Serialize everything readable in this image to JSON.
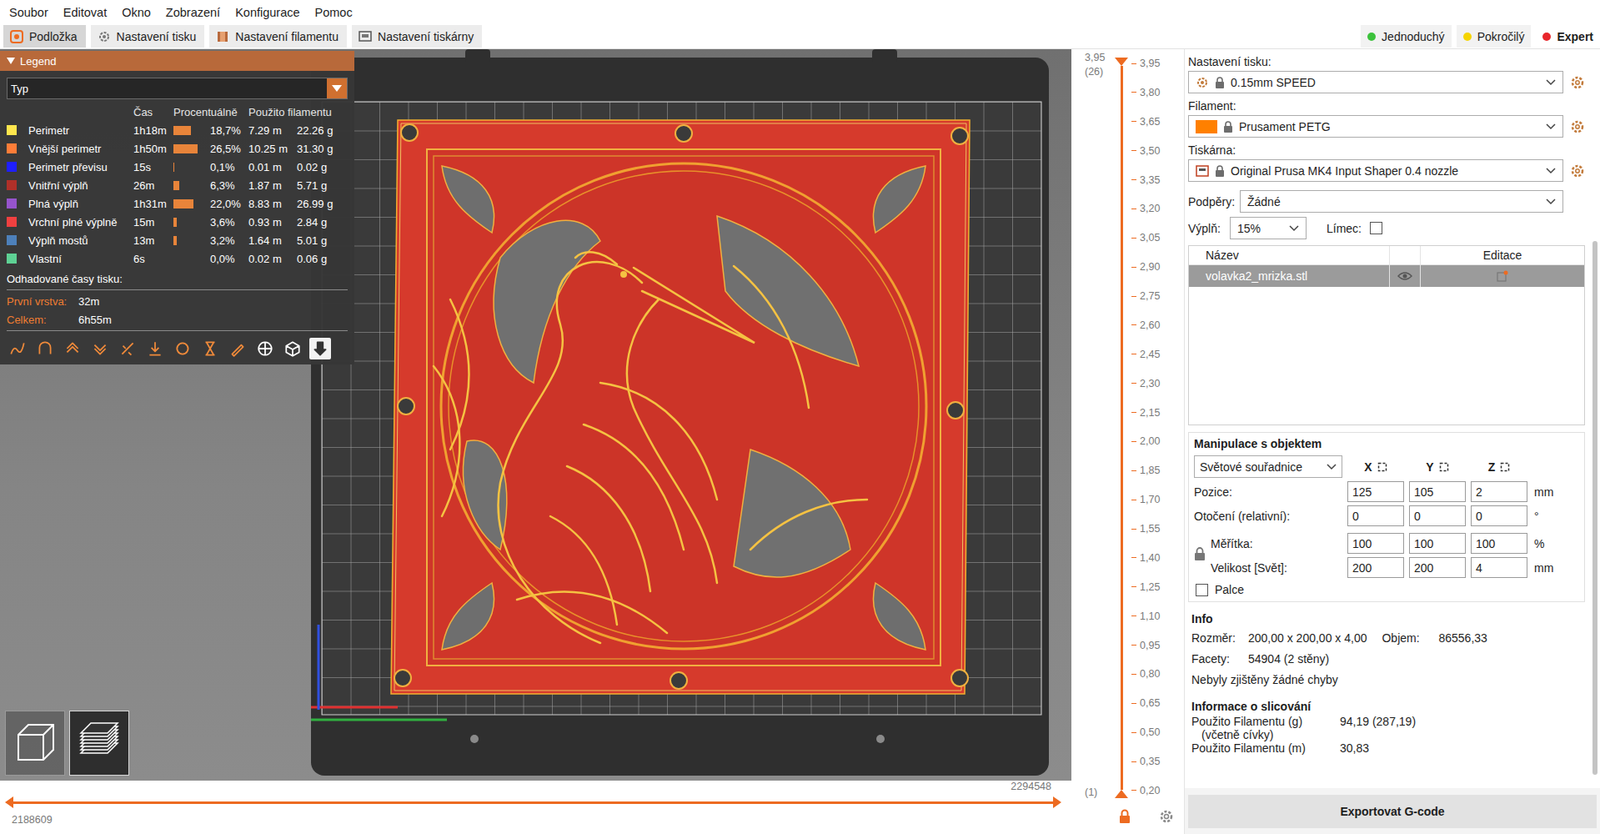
{
  "menu": [
    "Soubor",
    "Editovat",
    "Okno",
    "Zobrazení",
    "Konfigurace",
    "Pomoc"
  ],
  "tabs": [
    {
      "label": "Podložka",
      "selected": true
    },
    {
      "label": "Nastavení tisku",
      "selected": false
    },
    {
      "label": "Nastavení filamentu",
      "selected": false
    },
    {
      "label": "Nastavení tiskárny",
      "selected": false
    }
  ],
  "modes": [
    {
      "label": "Jednoduchý",
      "selected": false,
      "color": "#3cc23c"
    },
    {
      "label": "Pokročilý",
      "selected": false,
      "color": "#f5d400"
    },
    {
      "label": "Expert",
      "selected": true,
      "color": "#e8262b"
    }
  ],
  "legend": {
    "title": "Legend",
    "view_type": "Typ",
    "columns": [
      "Čas",
      "Procentuálně",
      "Použito filamentu"
    ],
    "rows": [
      {
        "name": "Perimetr",
        "color": "#ffe64d",
        "time": "1h18m",
        "percent": "18,7%",
        "level": 0.187,
        "length": "7.29 m",
        "weight": "22.26 g"
      },
      {
        "name": "Vnější perimetr",
        "color": "#ff7d38",
        "time": "1h50m",
        "percent": "26,5%",
        "level": 0.265,
        "length": "10.25 m",
        "weight": "31.30 g"
      },
      {
        "name": "Perimetr převisu",
        "color": "#1f1fff",
        "time": "15s",
        "percent": "0,1%",
        "level": 0.001,
        "length": "0.01 m",
        "weight": "0.02 g"
      },
      {
        "name": "Vnitřní výplň",
        "color": "#b03029",
        "time": "26m",
        "percent": "6,3%",
        "level": 0.063,
        "length": "1.87 m",
        "weight": "5.71 g"
      },
      {
        "name": "Plná výplň",
        "color": "#9654cc",
        "time": "1h31m",
        "percent": "22,0%",
        "level": 0.22,
        "length": "8.83 m",
        "weight": "26.99 g"
      },
      {
        "name": "Vrchní plné výplně",
        "color": "#f04040",
        "time": "15m",
        "percent": "3,6%",
        "level": 0.036,
        "length": "0.93 m",
        "weight": "2.84 g"
      },
      {
        "name": "Výplň mostů",
        "color": "#4d80ba",
        "time": "13m",
        "percent": "3,2%",
        "level": 0.032,
        "length": "1.64 m",
        "weight": "5.01 g"
      },
      {
        "name": "Vlastní",
        "color": "#5ed194",
        "time": "6s",
        "percent": "0,0%",
        "level": 0.0,
        "length": "0.02 m",
        "weight": "0.06 g"
      }
    ],
    "estimates_title": "Odhadované časy tisku:",
    "estimates": [
      {
        "label": "První vrstva:",
        "value": "32m"
      },
      {
        "label": "Celkem:",
        "value": "6h55m"
      }
    ],
    "toolbar": [
      {
        "selected": false
      },
      {
        "selected": false
      },
      {
        "selected": false
      },
      {
        "selected": false
      },
      {
        "selected": false
      },
      {
        "selected": false
      },
      {
        "selected": false
      },
      {
        "selected": false
      },
      {
        "selected": false
      },
      {
        "selected": false
      },
      {
        "selected": false
      },
      {
        "selected": true
      }
    ]
  },
  "view_buttons": [
    {
      "selected": false
    },
    {
      "selected": true
    }
  ],
  "layer_slider": {
    "top_value": "3,95",
    "top_layer": "(26)",
    "bottom_layer": "(1)",
    "upper_level": 1,
    "lower_level": 0,
    "ticks": [
      "3,95",
      "3,80",
      "3,65",
      "3,50",
      "3,35",
      "3,20",
      "3,05",
      "2,90",
      "2,75",
      "2,60",
      "2,45",
      "2,30",
      "2,15",
      "2,00",
      "1,85",
      "1,70",
      "1,55",
      "1,40",
      "1,25",
      "1,10",
      "0,95",
      "0,80",
      "0,65",
      "0,50",
      "0,35",
      "0,20"
    ]
  },
  "move_slider": {
    "start": "2188609",
    "end": "2294548",
    "lower_level": 0,
    "upper_level": 1
  },
  "sidebar": {
    "presets": [
      {
        "kind": "print",
        "label": "Nastavení tisku:",
        "value": "0.15mm SPEED",
        "locked": true
      },
      {
        "kind": "filament",
        "label": "Filament:",
        "value": "Prusament PETG",
        "locked": true,
        "color": "#ff8000"
      },
      {
        "kind": "printer",
        "label": "Tiskárna:",
        "value": "Original Prusa MK4 Input Shaper 0.4 nozzle",
        "locked": true
      }
    ],
    "supports": {
      "label": "Podpěry:",
      "value": "Žádné"
    },
    "infill": {
      "label": "Výplň:",
      "value": "15%"
    },
    "brim": {
      "label": "Límec:",
      "checked": false
    },
    "object_list": {
      "columns": [
        "Název",
        "Editace"
      ],
      "objects": [
        {
          "name": "volavka2_mrizka.stl",
          "selected": true,
          "visible": true
        }
      ]
    },
    "manipulation": {
      "title": "Manipulace s objektem",
      "coord_system": "Světové souřadnice",
      "axes": [
        "X",
        "Y",
        "Z"
      ],
      "rows": [
        {
          "label": "Pozice:",
          "values": [
            "125",
            "105",
            "2"
          ],
          "unit": "mm"
        },
        {
          "label": "Otočení (relativní):",
          "values": [
            "0",
            "0",
            "0"
          ],
          "unit": "°"
        }
      ],
      "scale_group": {
        "locked": true,
        "rows": [
          {
            "label": "Měřítka:",
            "values": [
              "100",
              "100",
              "100"
            ],
            "unit": "%"
          },
          {
            "label": "Velikost [Svět]:",
            "values": [
              "200",
              "200",
              "4"
            ],
            "unit": "mm"
          }
        ]
      },
      "inches": {
        "label": "Palce",
        "checked": false
      }
    },
    "info": {
      "title": "Info",
      "rows": [
        [
          {
            "label": "Rozměr:",
            "value": "200,00 x 200,00 x 4,00"
          },
          {
            "label": "Objem:",
            "value": "86556,33"
          }
        ],
        [
          {
            "label": "Facety:",
            "value": "54904 (2 stěny)"
          }
        ]
      ],
      "status": "Nebyly zjištěny žádné chyby"
    },
    "slicing": {
      "title": "Informace o slicování",
      "rows": [
        {
          "label": "Použito Filamentu (g)",
          "sublabel": "(včetně cívky)",
          "value": "94,19 (287,19)"
        },
        {
          "label": "Použito Filamentu (m)",
          "value": "30,83"
        }
      ]
    },
    "export_button": "Exportovat G-code"
  }
}
